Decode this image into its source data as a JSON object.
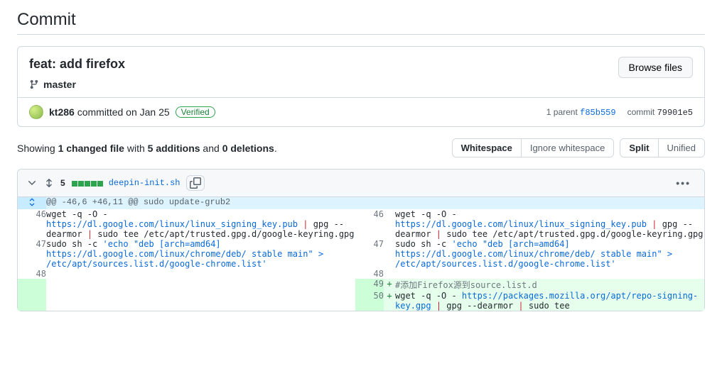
{
  "page": {
    "title": "Commit"
  },
  "commit": {
    "title": "feat: add firefox",
    "browse_label": "Browse files",
    "branch": "master",
    "author": "kt286",
    "action": " committed ",
    "date": "on Jan 25",
    "verified_label": "Verified",
    "parent_label": "1 parent ",
    "parent_sha": "f85b559",
    "commit_label": "commit ",
    "sha": "79901e5"
  },
  "summary": {
    "prefix": "Showing ",
    "files": "1 changed file",
    "mid1": " with ",
    "adds": "5 additions",
    "mid2": " and ",
    "dels": "0 deletions",
    "suffix": "."
  },
  "toolbar": {
    "whitespace": "Whitespace",
    "ignore_ws": "Ignore whitespace",
    "split": "Split",
    "unified": "Unified"
  },
  "file": {
    "additions": "5",
    "name": "deepin-init.sh",
    "hunk_header": "@@ -46,6 +46,11 @@ sudo update-grub2"
  },
  "diff": {
    "l46": "46",
    "r46": "46",
    "l47": "47",
    "r47": "47",
    "l48": "48",
    "r48": "48",
    "r49": "49",
    "r50": "50",
    "line46_a": "wget -q -O - ",
    "line46_url": "https://dl.google.com/linux/linux_signing_key.pub",
    "line46_b": " ",
    "line46_c": " gpg --dearmor ",
    "line46_d": " sudo tee /etc/apt/trusted.gpg.d/google-keyring.gpg",
    "line47_a": "sudo sh -c ",
    "line47_s1": "'echo \"deb [arch=amd64] ",
    "line47_url": "https://dl.google.com/linux/chrome/deb/",
    "line47_s2": " stable main\" > /etc/apt/sources.list.d/google-chrome.list'",
    "line48": "",
    "line49": "#添加Firefox源到source.list.d",
    "line50_a": "wget -q -O - ",
    "line50_url": "https://packages.mozilla.org/apt/repo-signing-key.gpg",
    "line50_b": " ",
    "line50_c": " gpg --dearmor ",
    "line50_d": " sudo tee ",
    "pipe": "|"
  }
}
